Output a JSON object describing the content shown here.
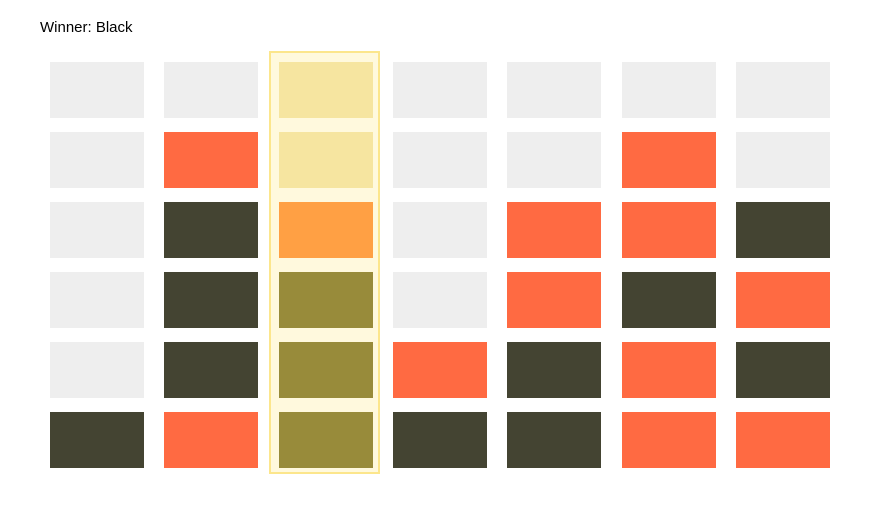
{
  "status": {
    "winner_text": "Winner: Black"
  },
  "board": {
    "rows": 6,
    "cols": 7,
    "highlighted_column": 2,
    "cells": [
      [
        "empty",
        "empty",
        "empty",
        "empty",
        "empty",
        "empty",
        "empty"
      ],
      [
        "empty",
        "red",
        "empty",
        "empty",
        "empty",
        "red",
        "empty"
      ],
      [
        "empty",
        "black",
        "red",
        "empty",
        "red",
        "red",
        "black"
      ],
      [
        "empty",
        "black",
        "black",
        "empty",
        "red",
        "black",
        "red"
      ],
      [
        "empty",
        "black",
        "black",
        "red",
        "black",
        "red",
        "black"
      ],
      [
        "black",
        "red",
        "black",
        "black",
        "black",
        "red",
        "red"
      ]
    ]
  },
  "colors": {
    "empty": "#eeeeee",
    "red": "#ff6a42",
    "black": "#444432",
    "empty_highlighted": "#f3e5ae",
    "red_highlighted": "#ff8833",
    "black_highlighted": "#766c26"
  }
}
